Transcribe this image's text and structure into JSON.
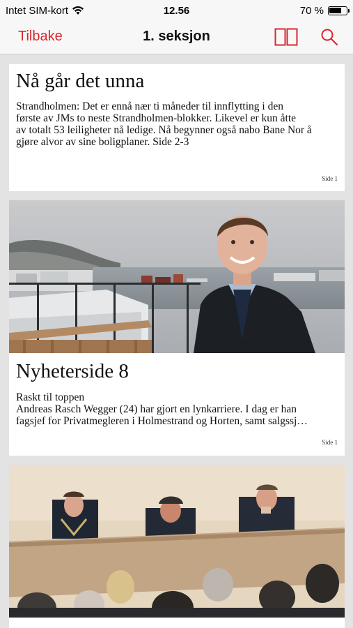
{
  "status_bar": {
    "carrier": "Intet SIM-kort",
    "time": "12.56",
    "battery": "70 %",
    "battery_level": 0.7
  },
  "nav": {
    "back_label": "Tilbake",
    "title": "1. seksjon",
    "spread_icon": "two-page-spread-icon",
    "search_icon": "search-icon",
    "accent_color": "#d8262e"
  },
  "articles": [
    {
      "headline": "Nå går det unna",
      "body_lines": [
        "Strandholmen: Det er ennå nær ti måneder til innflytting i den",
        "første av JMs to neste Strandholmen-blokker. Likevel er kun åtte",
        "av totalt 53 leiligheter nå ledige. Nå begynner også nabo Bane Nor å",
        "gjøre alvor av sine boligplaner. Side 2-3"
      ],
      "page": "Side 1"
    },
    {
      "headline": "Nyheterside 8",
      "body_lines": [
        "Raskt til toppen",
        "Andreas Rasch Wegger (24) har gjort en lynkarriere. I dag er han",
        "fagsjef for Privatmegleren i Holmestrand og Horten, samt salgssj…"
      ],
      "page": "Side 1"
    },
    {
      "headline": "",
      "body_lines": [],
      "page": ""
    }
  ]
}
